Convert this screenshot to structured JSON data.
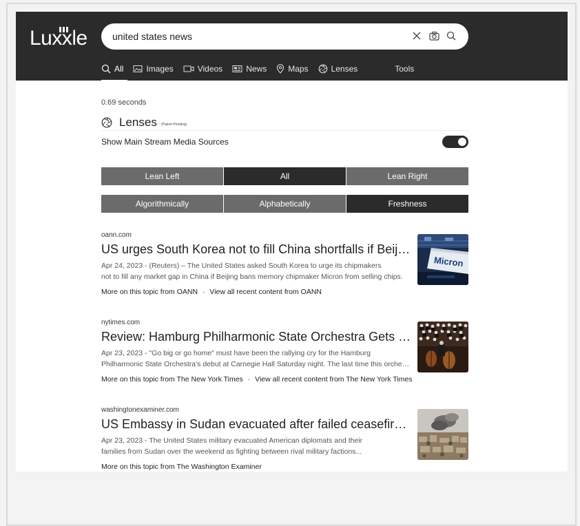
{
  "app": {
    "logo": "Luxxle"
  },
  "search": {
    "query": "united states news",
    "placeholder": ""
  },
  "tabs": [
    {
      "label": "All",
      "icon": "search-icon"
    },
    {
      "label": "Images",
      "icon": "image-icon"
    },
    {
      "label": "Videos",
      "icon": "video-icon"
    },
    {
      "label": "News",
      "icon": "newspaper-icon"
    },
    {
      "label": "Maps",
      "icon": "map-pin-icon"
    },
    {
      "label": "Lenses",
      "icon": "aperture-icon"
    },
    {
      "label": "Tools"
    }
  ],
  "timing": "0.69 seconds",
  "lenses": {
    "title": "Lenses",
    "subtitle": "(Patent Pending)"
  },
  "mainstream": {
    "label": "Show Main Stream Media Sources",
    "enabled": true
  },
  "bias_filter": {
    "options": [
      "Lean Left",
      "All",
      "Lean Right"
    ],
    "selected": "All"
  },
  "sort_filter": {
    "options": [
      "Algorithmically",
      "Alphabetically",
      "Freshness"
    ],
    "selected": "Freshness"
  },
  "results": [
    {
      "domain": "oann.com",
      "title": "US urges South Korea not to fill China shortfalls if Beijing bans Micron chips",
      "snippet_line1": "Apr 24, 2023 - (Reuters) – The United States asked South Korea to urge its chipmakers",
      "snippet_line2": "not to fill any market gap in China if Beijing bans memory chipmaker Micron from selling chips.",
      "more_from": "More on this topic from OANN",
      "separator": "·",
      "view_all": "View all recent content from OANN",
      "thumb_text": "Micron"
    },
    {
      "domain": "nytimes.com",
      "title": "Review: Hamburg Philharmonic State Orchestra Gets Personal",
      "snippet_line1": "Apr 23, 2023 - \"Go big or go home\" must have been the rallying cry for the Hamburg",
      "snippet_line2": "Philharmonic State Orchestra's debut at Carnegie Hall Saturday night. The last time this orchestra",
      "more_from": "More on this topic from The New York Times",
      "separator": "·",
      "view_all": "View all recent content from The New York Times"
    },
    {
      "domain": "washingtonexaminer.com",
      "title": "US Embassy in Sudan evacuated after failed ceasefire sparks fighting",
      "snippet_line1": "Apr 23, 2023 - The United States military evacuated American diplomats and their",
      "snippet_line2": "families from Sudan over the weekend as fighting between rival military factions...",
      "more_from": "More on this topic from The Washington Examiner"
    }
  ],
  "colors": {
    "header": "#2b2b2b",
    "segment": "#6b6b6b",
    "segment_selected": "#2b2b2b"
  }
}
